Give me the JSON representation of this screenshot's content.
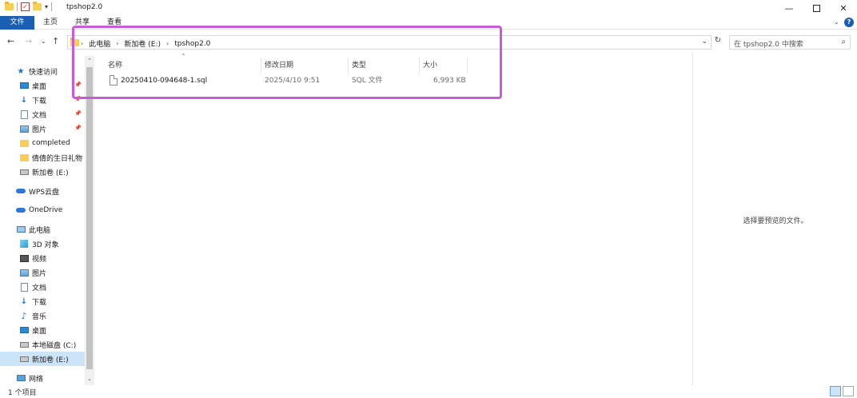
{
  "window": {
    "title": "tpshop2.0",
    "controls": {
      "minimize": "—",
      "close": "✕"
    }
  },
  "ribbon": {
    "tabs": [
      "文件",
      "主页",
      "共享",
      "查看"
    ]
  },
  "address": {
    "crumbs": [
      "此电脑",
      "新加卷 (E:)",
      "tpshop2.0"
    ],
    "search_placeholder": "搜索\"tpshop2.0\"",
    "search_display": "在 tpshop2.0 中搜索"
  },
  "sidebar": {
    "items": [
      {
        "label": "快速访问",
        "icon": "star-icon",
        "pinned": false
      },
      {
        "label": "桌面",
        "icon": "desktop-icon",
        "pinned": true
      },
      {
        "label": "下载",
        "icon": "download-icon",
        "pinned": true
      },
      {
        "label": "文档",
        "icon": "document-icon",
        "pinned": true
      },
      {
        "label": "图片",
        "icon": "picture-icon",
        "pinned": true
      },
      {
        "label": "completed",
        "icon": "folder-icon",
        "pinned": false
      },
      {
        "label": "倩倩的生日礼物",
        "icon": "folder-icon",
        "pinned": false
      },
      {
        "label": "新加卷 (E:)",
        "icon": "drive-icon",
        "pinned": false
      },
      {
        "label": "WPS云盘",
        "icon": "cloud-icon",
        "pinned": false
      },
      {
        "label": "OneDrive",
        "icon": "cloud-icon",
        "pinned": false
      },
      {
        "label": "此电脑",
        "icon": "computer-icon",
        "pinned": false
      },
      {
        "label": "3D 对象",
        "icon": "3d-objects-icon",
        "pinned": false
      },
      {
        "label": "视频",
        "icon": "video-icon",
        "pinned": false
      },
      {
        "label": "图片",
        "icon": "picture-icon",
        "pinned": false
      },
      {
        "label": "文档",
        "icon": "document-icon",
        "pinned": false
      },
      {
        "label": "下载",
        "icon": "download-icon",
        "pinned": false
      },
      {
        "label": "音乐",
        "icon": "music-icon",
        "pinned": false
      },
      {
        "label": "桌面",
        "icon": "desktop-icon",
        "pinned": false
      },
      {
        "label": "本地磁盘 (C:)",
        "icon": "drive-icon",
        "pinned": false
      },
      {
        "label": "新加卷 (E:)",
        "icon": "drive-icon",
        "pinned": false,
        "active": true
      },
      {
        "label": "网络",
        "icon": "network-icon",
        "pinned": false
      }
    ]
  },
  "file_list": {
    "columns": [
      "名称",
      "修改日期",
      "类型",
      "大小"
    ],
    "rows": [
      {
        "name": "20250410-094648-1.sql",
        "modified": "2025/4/10 9:51",
        "type": "SQL 文件",
        "size": "6,993 KB"
      }
    ]
  },
  "preview": {
    "message": "选择要预览的文件。"
  },
  "status": {
    "text": "1 个项目"
  },
  "colors": {
    "accent": "#1a5fb4",
    "highlight_box": "#c75cd6",
    "selected": "#cce4f7"
  }
}
